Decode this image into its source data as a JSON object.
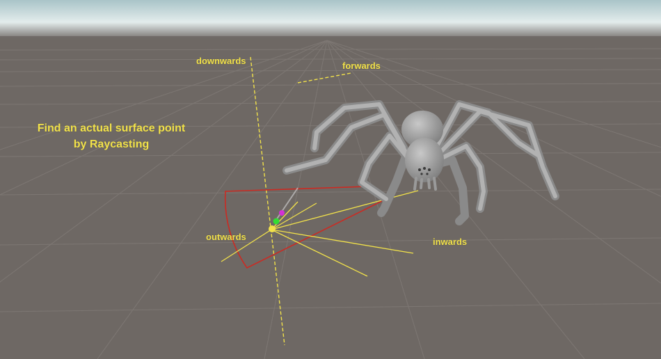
{
  "scene": {
    "caption": {
      "line1": "Find an actual surface point",
      "line2": "by Raycasting"
    },
    "labels": {
      "downwards": "downwards",
      "forwards": "forwards",
      "outwards": "outwards",
      "inwards": "inwards"
    },
    "colors": {
      "ground": "#6e6864",
      "sky": "#dfe9ea",
      "grid": "#827c78",
      "ray": "#f2e24a",
      "arc": "#cc2a22",
      "spider": "#9d9d9d",
      "marker_green": "#33dd33",
      "marker_magenta": "#d430d4"
    }
  }
}
